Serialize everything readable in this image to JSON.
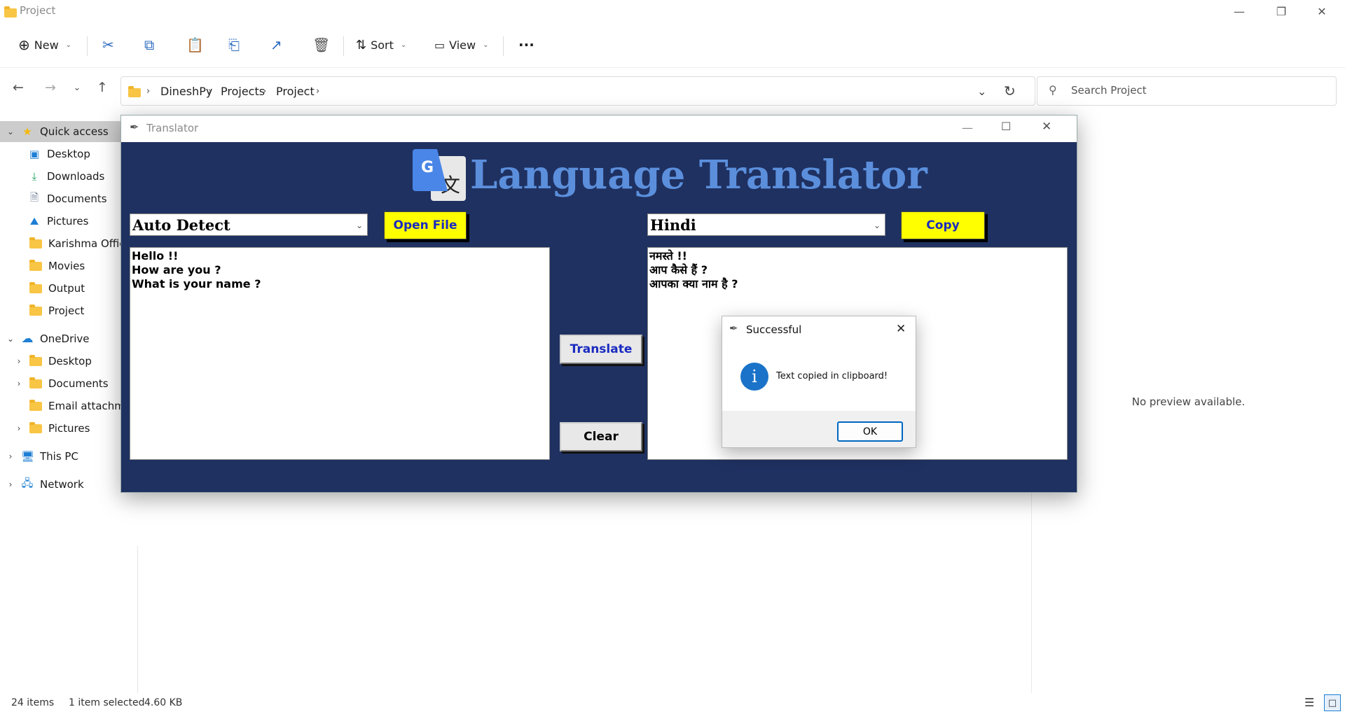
{
  "explorer": {
    "window_title": "Project",
    "toolbar": {
      "new_label": "New",
      "sort_label": "Sort",
      "view_label": "View",
      "more_label": "···"
    },
    "breadcrumbs": [
      "DineshPy",
      "Projects",
      "Project"
    ],
    "search_placeholder": "Search Project",
    "sidebar": {
      "quick_access": "Quick access",
      "quick_items": [
        "Desktop",
        "Downloads",
        "Documents",
        "Pictures",
        "Karishma Office",
        "Movies",
        "Output",
        "Project"
      ],
      "onedrive": "OneDrive",
      "onedrive_items": [
        "Desktop",
        "Documents",
        "Email attachmer",
        "Pictures"
      ],
      "this_pc": "This PC",
      "network": "Network"
    },
    "preview_text": "No preview available.",
    "status": {
      "item_count": "24 items",
      "selection": "1 item selected",
      "size": "4.60 KB"
    }
  },
  "translator": {
    "window_title": "Translator",
    "heading": "Language Translator",
    "logo_letters": {
      "g": "G",
      "glyph": "文"
    },
    "source_language": "Auto Detect",
    "target_language": "Hindi",
    "open_file_label": "Open File",
    "copy_label": "Copy",
    "translate_label": "Translate",
    "clear_label": "Clear",
    "source_lines": [
      "Hello !!",
      "How are you ?",
      "What is your name ?"
    ],
    "target_lines": [
      "नमस्ते !!",
      "आप कैसे हैं ?",
      "आपका क्या नाम है ?"
    ],
    "colors": {
      "background": "#1f3161",
      "heading": "#5b8fdc",
      "yellow_button": "#ffff00"
    }
  },
  "dialog": {
    "title": "Successful",
    "message": "Text copied in clipboard!",
    "ok_label": "OK",
    "info_icon_glyph": "i"
  }
}
